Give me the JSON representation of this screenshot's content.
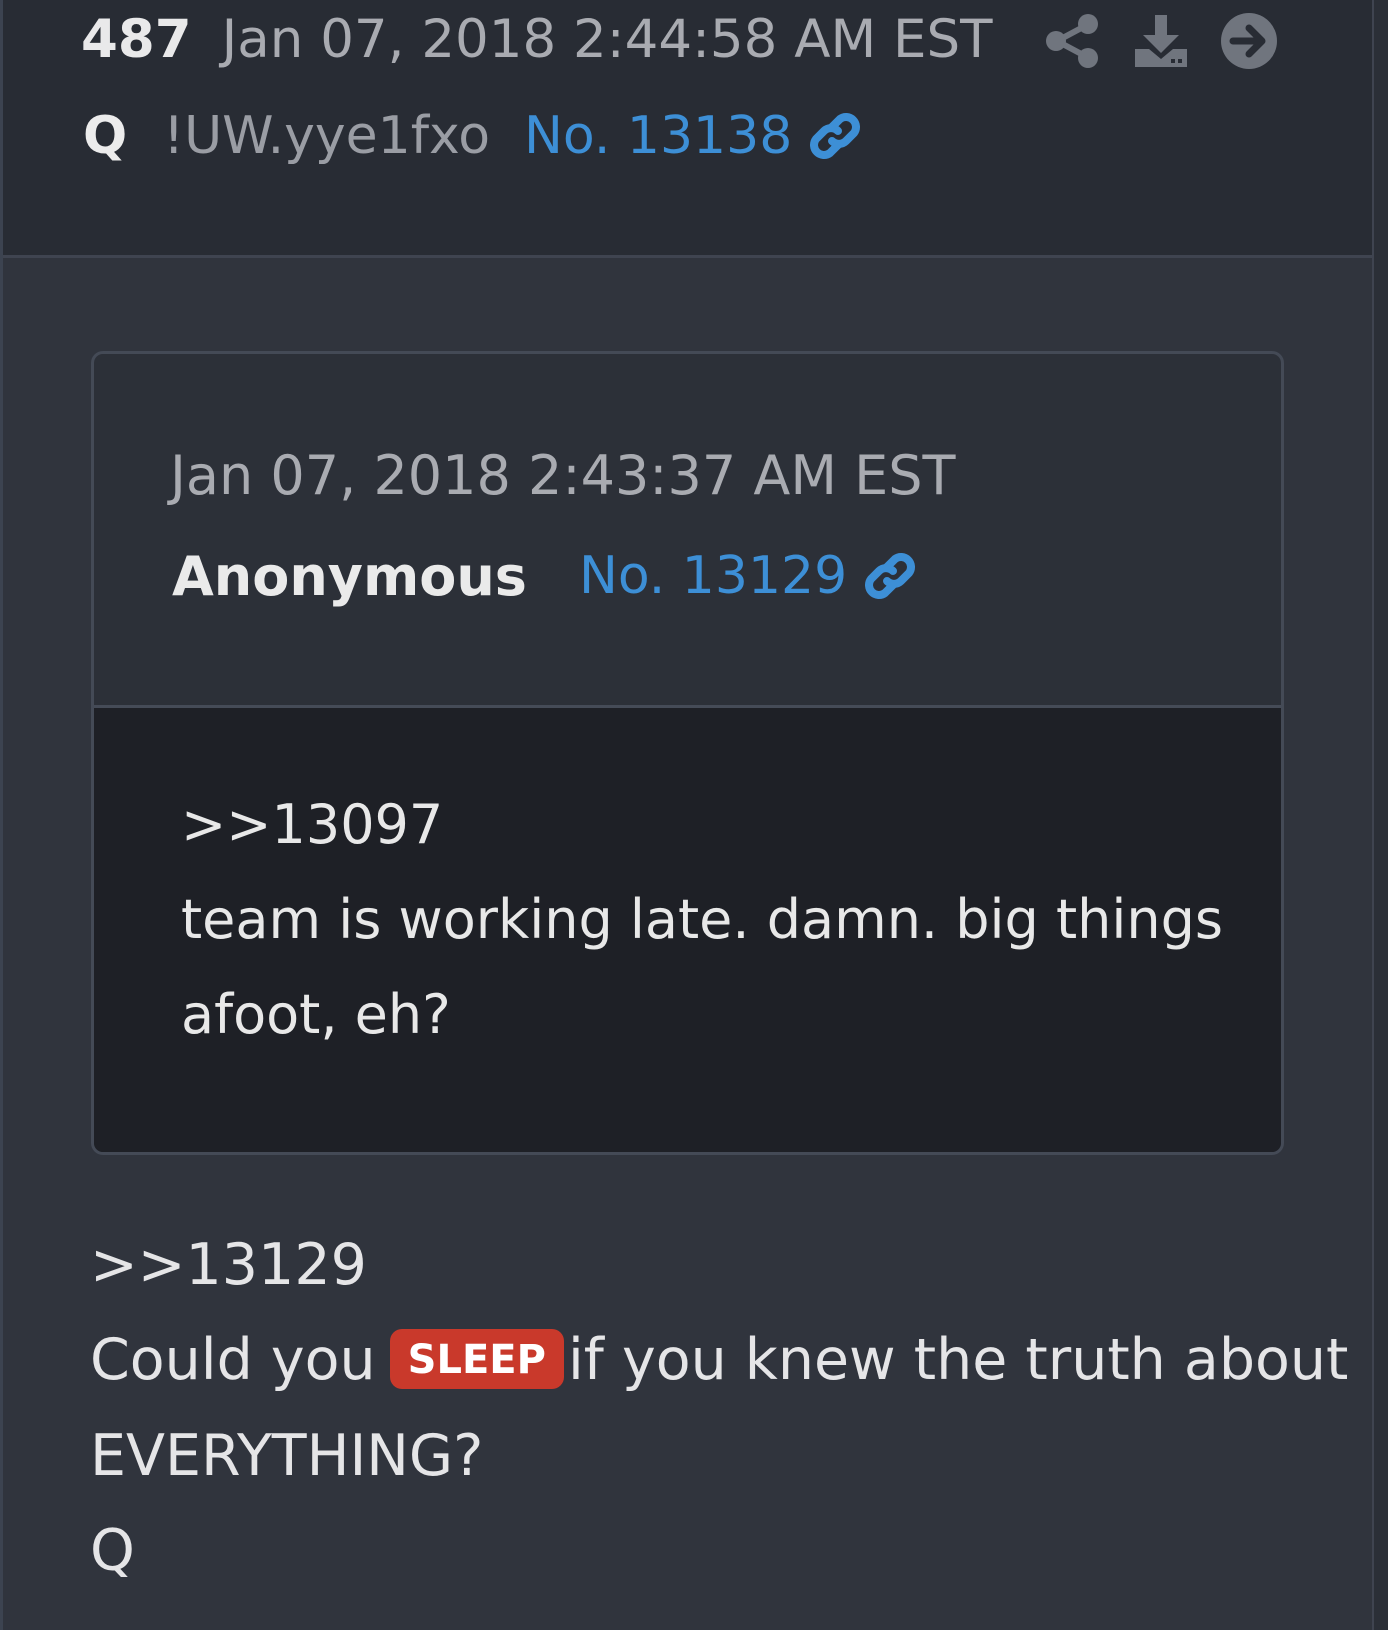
{
  "post": {
    "count": "487",
    "date": "Jan 07, 2018 2:44:58 AM EST",
    "author": "Q",
    "tripcode": "!UW.yye1fxo",
    "number": "No. 13138",
    "actions": [
      "share-icon",
      "download-icon",
      "arrow-right-icon"
    ]
  },
  "quoted_post": {
    "date": "Jan 07, 2018 2:43:37 AM EST",
    "author": "Anonymous",
    "number": "No. 13129",
    "body": [
      ">>13097",
      "team is working late. damn. big things",
      "afoot, eh?"
    ]
  },
  "body": {
    "ref": ">>13129",
    "line1_before": "Could you",
    "badge": "SLEEP",
    "line1_after": "if you knew the truth about",
    "line2": "EVERYTHING?",
    "signature": "Q"
  },
  "colors": {
    "background": "#30343d",
    "header_bg": "#282c34",
    "link": "#3d8fd6",
    "badge": "#c9392b",
    "quote_body_bg": "#1e2026"
  }
}
